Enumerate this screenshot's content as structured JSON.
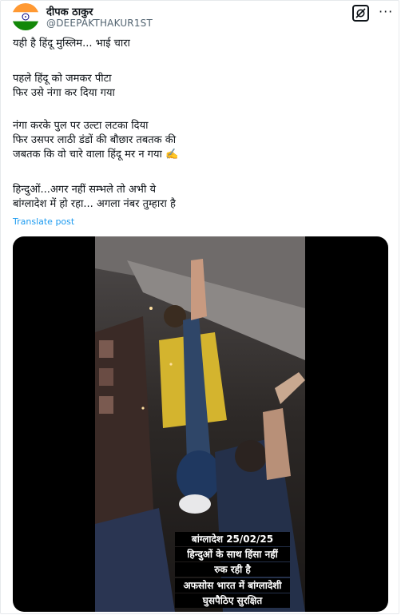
{
  "author": {
    "display_name": "दीपक ठाकुर",
    "handle": "@DEEPAKTHAKUR1ST",
    "avatar_icon": "india-flag-icon"
  },
  "actions": {
    "grok_icon": "grok-icon",
    "more_icon": "more-options-icon"
  },
  "post": {
    "lines": [
      "यही है हिंदू मुस्लिम... भाई  चारा",
      "पहले हिंदू को जमकर पीटा",
      "फिर उसे नंगा कर दिया गया",
      "नंगा करके पुल पर उल्टा लटका दिया",
      "फिर उसपर लाठी डंडों की बौछार तबतक की",
      "जबतक कि वो चारे वाला हिंदू मर न गया ✍️",
      "हिन्दुओं...अगर नहीं सम्भले तो अभी ये",
      "बांग्लादेश में हो रहा... अगला नंबर तुम्हारा है"
    ],
    "translate_label": "Translate post"
  },
  "media": {
    "caption_lines": [
      "बांग्लादेश 25/02/25",
      "हिन्दुओं के साथ हिंसा नहीं",
      "रुक रही है",
      "अफसोस भारत में बांग्लादेशी",
      "घुसपैठिए सुरक्षित"
    ]
  },
  "colors": {
    "link": "#1d9bf0",
    "secondary_text": "#536471",
    "saffron": "#FF9933",
    "green": "#138808",
    "navy": "#000080"
  }
}
